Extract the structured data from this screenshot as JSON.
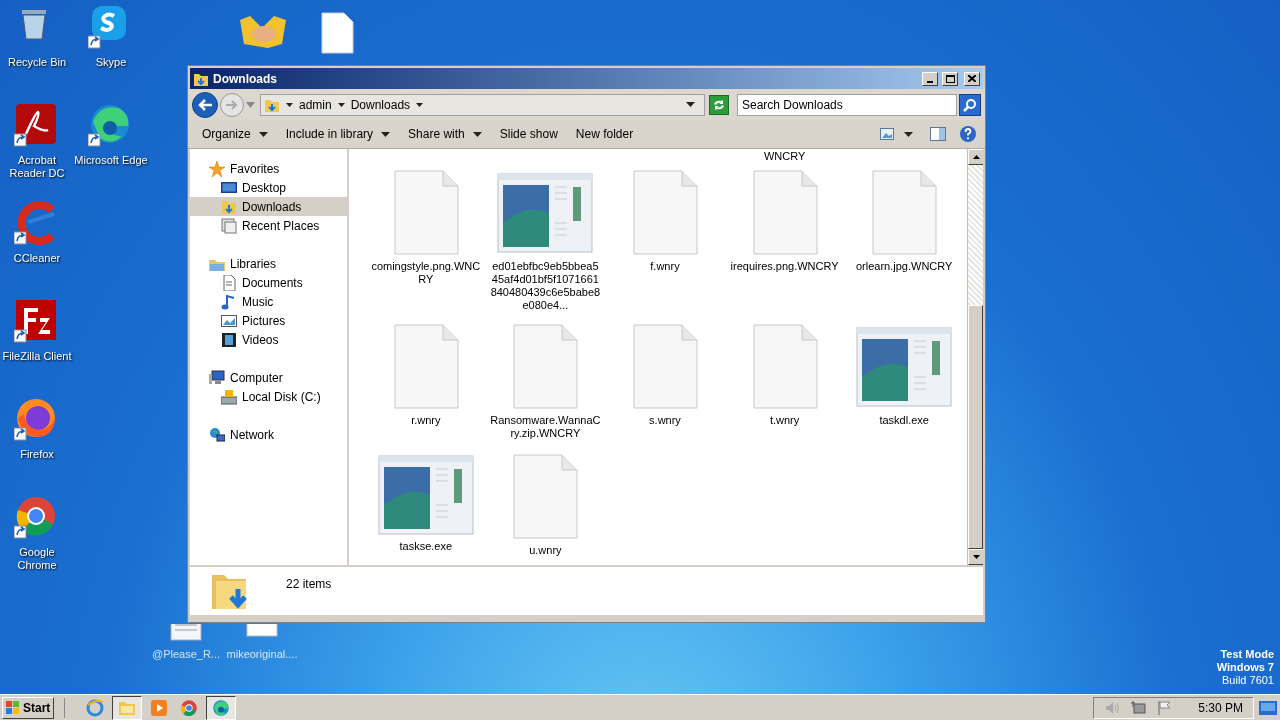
{
  "desktop_icons": [
    {
      "label": "Recycle Bin",
      "kind": "bin"
    },
    {
      "label": "Skype",
      "kind": "skype"
    },
    {
      "label": "Acrobat Reader DC",
      "kind": "acrobat"
    },
    {
      "label": "Microsoft Edge",
      "kind": "edge"
    },
    {
      "label": "CCleaner",
      "kind": "ccleaner"
    },
    {
      "label": "FileZilla Client",
      "kind": "filezilla"
    },
    {
      "label": "Firefox",
      "kind": "firefox"
    },
    {
      "label": "Google Chrome",
      "kind": "chrome"
    }
  ],
  "desktop_files": [
    {
      "label": "@Please_R...",
      "kind": "note"
    },
    {
      "label": "mikeoriginal....",
      "kind": "blank"
    }
  ],
  "window": {
    "title": "Downloads",
    "breadcrumb": [
      "admin",
      "Downloads"
    ],
    "search": {
      "placeholder": "Search Downloads"
    },
    "toolbar": [
      {
        "label": "Organize",
        "dropdown": true
      },
      {
        "label": "Include in library",
        "dropdown": true
      },
      {
        "label": "Share with",
        "dropdown": true
      },
      {
        "label": "Slide show",
        "dropdown": false
      },
      {
        "label": "New folder",
        "dropdown": false
      }
    ],
    "nav": [
      {
        "label": "Favorites",
        "kind": "star",
        "selected": false,
        "children": [
          {
            "label": "Desktop",
            "kind": "desktop",
            "selected": false
          },
          {
            "label": "Downloads",
            "kind": "downloads",
            "selected": true
          },
          {
            "label": "Recent Places",
            "kind": "recent",
            "selected": false
          }
        ]
      },
      {
        "label": "Libraries",
        "kind": "library",
        "selected": false,
        "children": [
          {
            "label": "Documents",
            "kind": "doc",
            "selected": false
          },
          {
            "label": "Music",
            "kind": "music",
            "selected": false
          },
          {
            "label": "Pictures",
            "kind": "pictures",
            "selected": false
          },
          {
            "label": "Videos",
            "kind": "videos",
            "selected": false
          }
        ]
      },
      {
        "label": "Computer",
        "kind": "computer",
        "selected": false,
        "children": [
          {
            "label": "Local Disk (C:)",
            "kind": "disk",
            "selected": false
          }
        ]
      },
      {
        "label": "Network",
        "kind": "network",
        "selected": false
      }
    ],
    "cut_label": "WNCRY",
    "files": [
      {
        "name": "comingstyle.png.WNCRY",
        "kind": "document"
      },
      {
        "name": "ed01ebfbc9eb5bbea545af4d01bf5f1071661840480439c6e5babe8e080e4...",
        "kind": "app"
      },
      {
        "name": "f.wnry",
        "kind": "document"
      },
      {
        "name": "irequires.png.WNCRY",
        "kind": "document"
      },
      {
        "name": "orlearn.jpg.WNCRY",
        "kind": "document"
      },
      {
        "name": "r.wnry",
        "kind": "document"
      },
      {
        "name": "Ransomware.WannaCry.zip.WNCRY",
        "kind": "document"
      },
      {
        "name": "s.wnry",
        "kind": "document"
      },
      {
        "name": "t.wnry",
        "kind": "document"
      },
      {
        "name": "taskdl.exe",
        "kind": "app"
      },
      {
        "name": "taskse.exe",
        "kind": "app"
      },
      {
        "name": "u.wnry",
        "kind": "document"
      }
    ],
    "item_count": "22 items"
  },
  "watermark_text": [
    "Test Mode",
    "Windows 7",
    "Build 7601"
  ],
  "taskbar": {
    "start": "Start",
    "apps": [
      {
        "kind": "ie",
        "selected": false
      },
      {
        "kind": "explorer",
        "selected": true
      },
      {
        "kind": "media",
        "selected": false
      },
      {
        "kind": "chrome",
        "selected": false
      },
      {
        "kind": "edge",
        "selected": true
      }
    ],
    "clock": "5:30 PM"
  }
}
